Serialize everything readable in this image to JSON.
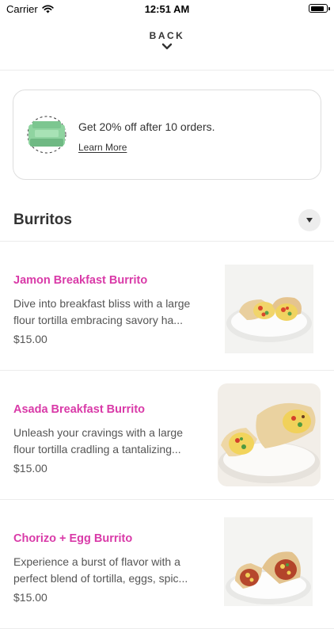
{
  "status": {
    "carrier": "Carrier",
    "time": "12:51 AM",
    "battery_level": 0.9
  },
  "header": {
    "back_label": "BACK"
  },
  "promo": {
    "text": "Get 20% off after 10 orders.",
    "link": "Learn More"
  },
  "section": {
    "title": "Burritos"
  },
  "items": [
    {
      "name": "Jamon Breakfast Burrito",
      "desc_line1": "Dive into breakfast bliss with a large",
      "desc_line2": "flour tortilla embracing savory ha...",
      "price": "$15.00"
    },
    {
      "name": "Asada Breakfast Burrito",
      "desc_line1": "Unleash your cravings with a large",
      "desc_line2": "flour tortilla cradling a tantalizing...",
      "price": "$15.00"
    },
    {
      "name": "Chorizo + Egg Burrito",
      "desc_line1": "Experience a burst of flavor with a",
      "desc_line2": "perfect blend of tortilla, eggs, spic...",
      "price": "$15.00"
    }
  ],
  "colors": {
    "accent": "#d93aa8",
    "promo_icon": "#8fd4a0"
  }
}
